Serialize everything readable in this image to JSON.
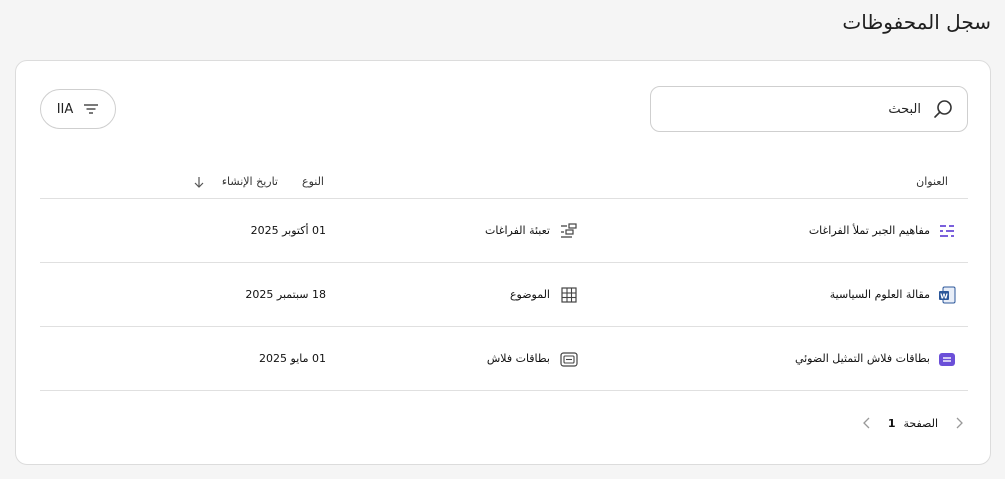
{
  "page": {
    "title": "سجل المحفوظات"
  },
  "search": {
    "placeholder": "البحث"
  },
  "filter": {
    "label": "IIA"
  },
  "table": {
    "headers": {
      "title": "العنوان",
      "type": "النوع",
      "date": "تاريخ الإنشاء"
    },
    "rows": [
      {
        "title": "مفاهيم الجبر تملأ الفراغات",
        "icon": "fill-blanks-icon",
        "type": "تعبئة الفراغات",
        "type_icon": "fill-blanks-type-icon",
        "date": "01 أكتوبر 2025"
      },
      {
        "title": "مقالة العلوم السياسية",
        "icon": "word-document-icon",
        "type": "الموضوع",
        "type_icon": "grid-icon",
        "date": "18 سبتمبر 2025"
      },
      {
        "title": "بطاقات فلاش التمثيل الضوئي",
        "icon": "flashcards-icon",
        "type": "بطاقات فلاش",
        "type_icon": "flashcards-type-icon",
        "date": "01 مايو 2025"
      }
    ]
  },
  "pagination": {
    "label": "الصفحة",
    "page": "1"
  },
  "colors": {
    "accent": "#6b4fd8",
    "word_blue": "#2b579a"
  }
}
